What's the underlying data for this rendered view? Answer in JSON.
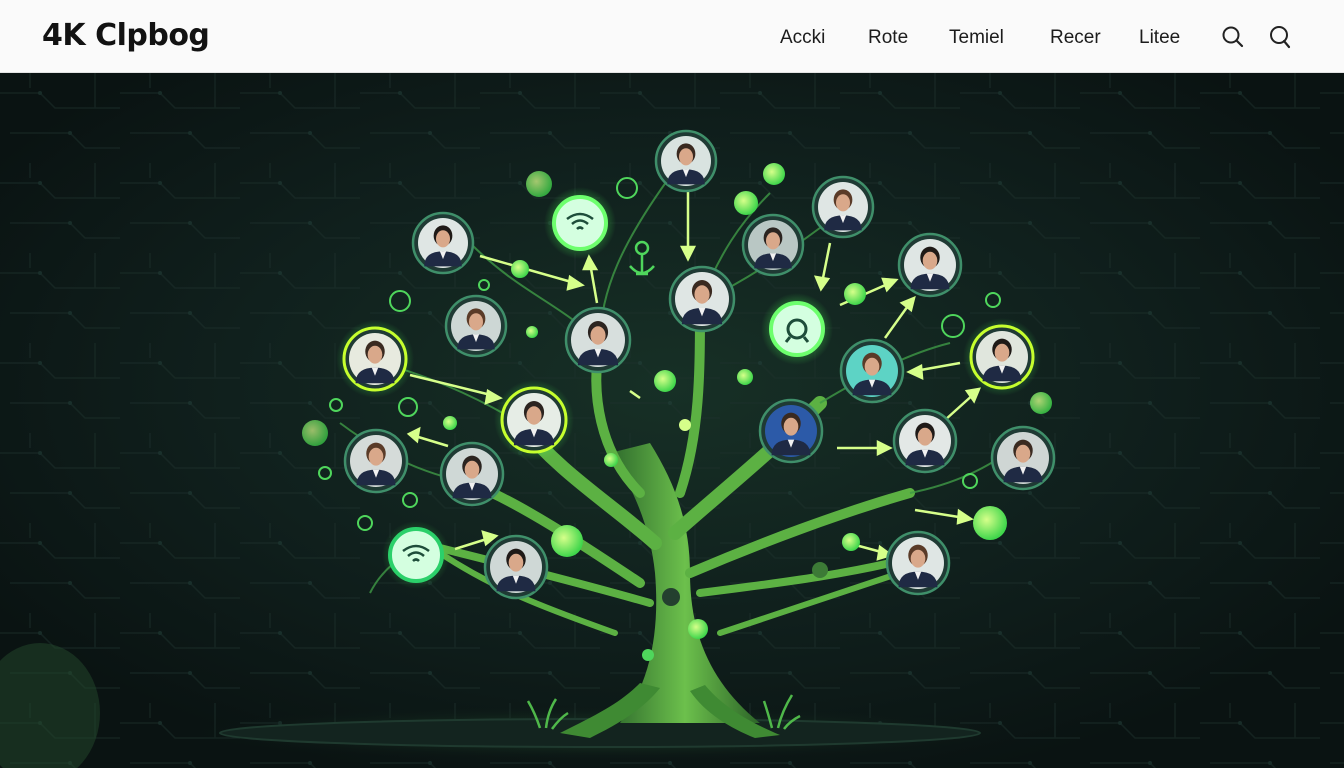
{
  "header": {
    "logo_text": "4K Clpbog",
    "nav": [
      {
        "label": "Accki"
      },
      {
        "label": "Rote"
      },
      {
        "label": "Temiel"
      },
      {
        "label": "Recer"
      },
      {
        "label": "Litee"
      }
    ],
    "icons": [
      "search-icon",
      "chat-search-icon"
    ]
  },
  "hero": {
    "illustration": "glowing-network-tree",
    "avatar_count": 18,
    "accent_colors": {
      "glow_green": "#5cff6a",
      "lime": "#c6ff2e",
      "trunk": "#4b9a3a",
      "background": "#0d1716"
    }
  }
}
